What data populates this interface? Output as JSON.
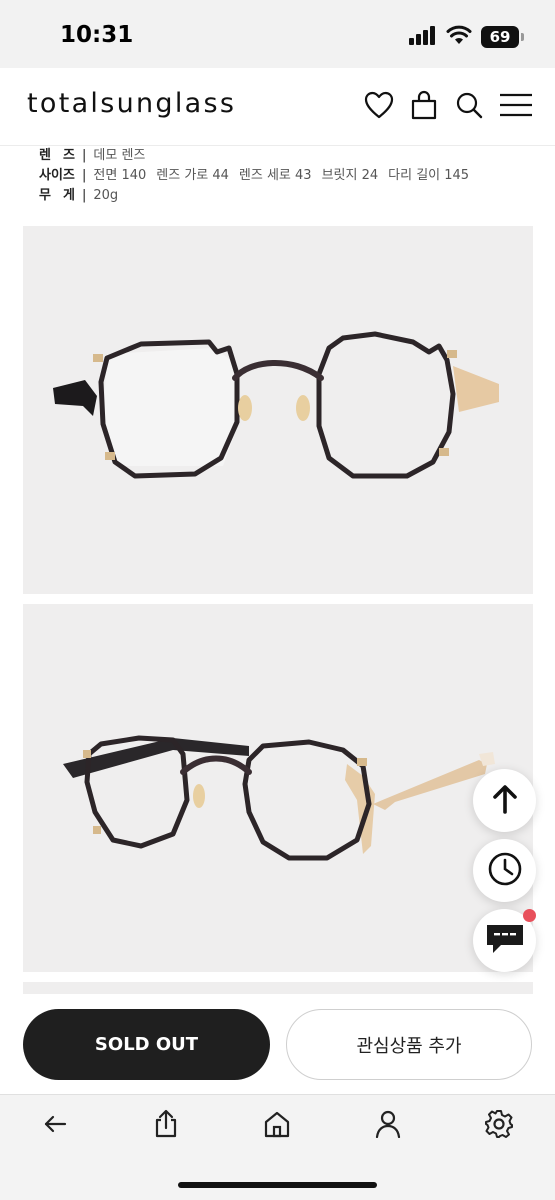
{
  "status_bar": {
    "time": "10:31",
    "battery": "69"
  },
  "header": {
    "logo": "totalsunglass",
    "icons": [
      "heart-icon",
      "shopping-bag-icon",
      "search-icon",
      "menu-icon"
    ]
  },
  "specs": {
    "rows": [
      {
        "key": "렌 즈",
        "value_parts": [
          "데모 렌즈"
        ]
      },
      {
        "key": "사이즈",
        "value_parts": [
          "전면 140",
          "렌즈 가로 44",
          "렌즈 세로 43",
          "브릿지 24",
          "다리 길이 145"
        ]
      },
      {
        "key": "무 게",
        "value_parts": [
          "20g"
        ]
      }
    ],
    "separator": "|"
  },
  "floating_buttons": {
    "icons": [
      "arrow-up-icon",
      "clock-icon",
      "chat-icon"
    ],
    "notification_color": "#e8505b"
  },
  "actions": {
    "sold_out_label": "SOLD OUT",
    "wishlist_label": "관심상품 추가"
  },
  "browser_toolbar": {
    "icons": [
      "back-arrow-icon",
      "share-icon",
      "home-icon",
      "profile-icon",
      "settings-icon"
    ]
  }
}
